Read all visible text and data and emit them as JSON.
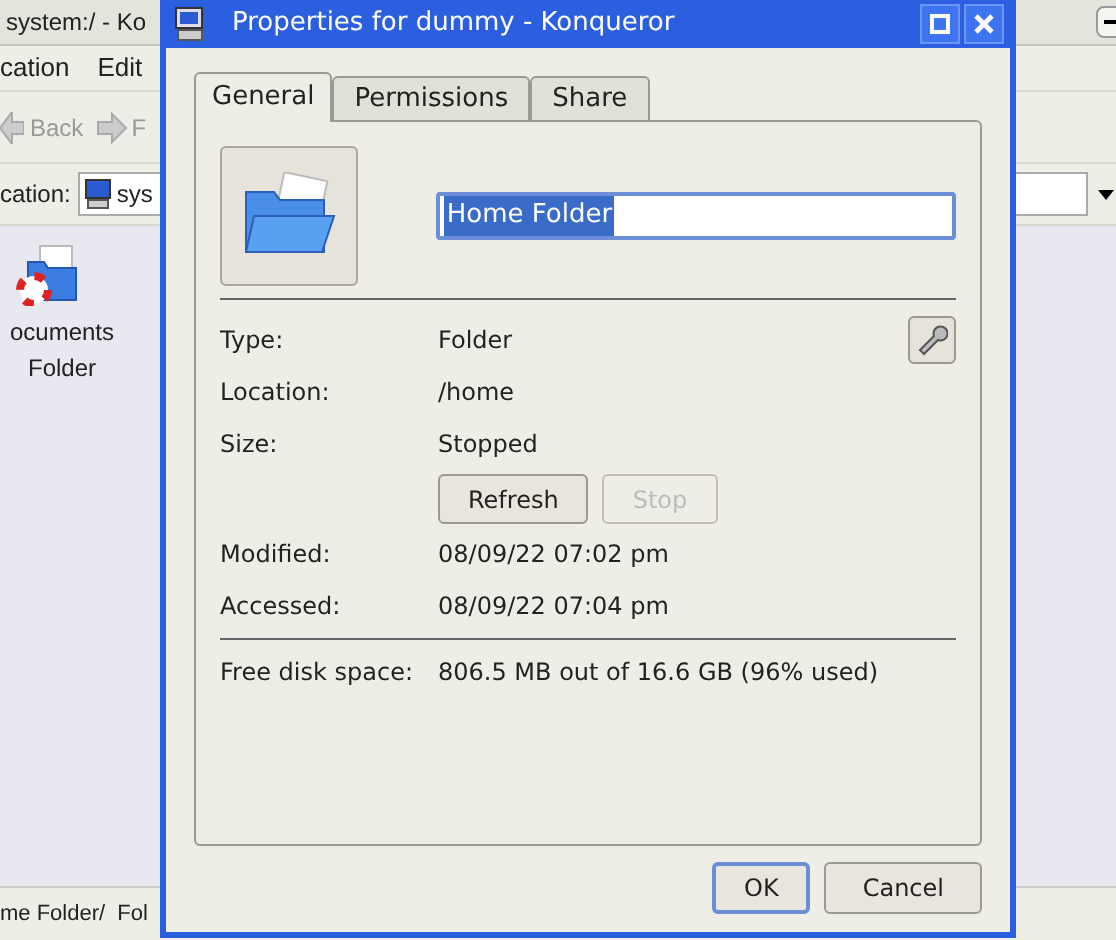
{
  "background_window": {
    "title": "system:/ - Ko",
    "menu": [
      "cation",
      "Edit"
    ],
    "toolbar": {
      "back": "Back",
      "forward": "F"
    },
    "location_label": "cation:",
    "location_value": "sys",
    "desktop_icon_label": "ocuments Folder",
    "status_bar": "me Folder/  Fol"
  },
  "dialog": {
    "title": "Properties for dummy - Konqueror",
    "tabs": [
      {
        "label": "General",
        "selected": true
      },
      {
        "label": "Permissions",
        "selected": false
      },
      {
        "label": "Share",
        "selected": false
      }
    ],
    "name_field": {
      "value": "Home Folder",
      "text_selected": true
    },
    "info_rows": [
      {
        "label": "Type:",
        "value": "Folder"
      },
      {
        "label": "Location:",
        "value": "/home"
      },
      {
        "label": "Size:",
        "value": "Stopped"
      }
    ],
    "size_buttons": [
      {
        "label": "Refresh",
        "disabled": false
      },
      {
        "label": "Stop",
        "disabled": true
      }
    ],
    "date_rows": [
      {
        "label": "Modified:",
        "value": "08/09/22 07:02 pm"
      },
      {
        "label": "Accessed:",
        "value": "08/09/22 07:04 pm"
      }
    ],
    "disk_row": {
      "label": "Free disk space:",
      "value": "806.5 MB out of 16.6 GB (96% used)"
    },
    "buttons": [
      {
        "label": "OK",
        "default": true
      },
      {
        "label": "Cancel",
        "default": false
      }
    ]
  }
}
